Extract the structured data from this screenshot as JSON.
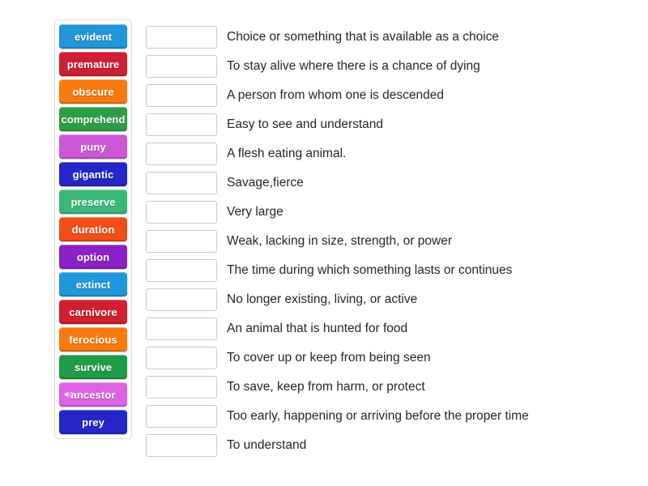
{
  "activity": {
    "type": "match-up-drag-and-drop",
    "tile_panel": {
      "tiles": [
        {
          "label": "evident",
          "color": "#2196d8",
          "has_audio": false
        },
        {
          "label": "premature",
          "color": "#cf1f35",
          "has_audio": false
        },
        {
          "label": "obscure",
          "color": "#f97b0f",
          "has_audio": false
        },
        {
          "label": "comprehend",
          "color": "#2e9e46",
          "has_audio": false
        },
        {
          "label": "puny",
          "color": "#cc58d8",
          "has_audio": false
        },
        {
          "label": "gigantic",
          "color": "#2525c8",
          "has_audio": false
        },
        {
          "label": "preserve",
          "color": "#3cb878",
          "has_audio": false
        },
        {
          "label": "duration",
          "color": "#f04e16",
          "has_audio": false
        },
        {
          "label": "option",
          "color": "#8a22c8",
          "has_audio": false
        },
        {
          "label": "extinct",
          "color": "#1f97db",
          "has_audio": false
        },
        {
          "label": "carnivore",
          "color": "#d01f30",
          "has_audio": false
        },
        {
          "label": "ferocious",
          "color": "#f97b0f",
          "has_audio": false
        },
        {
          "label": "survive",
          "color": "#219a45",
          "has_audio": false
        },
        {
          "label": "ancestor",
          "color": "#dd63e4",
          "has_audio": true,
          "audio_icon": "speaker-icon"
        },
        {
          "label": "prey",
          "color": "#2525c8",
          "has_audio": false
        }
      ]
    },
    "rows": [
      {
        "answer": "",
        "definition": "Choice or something that is available as a choice"
      },
      {
        "answer": "",
        "definition": "To stay alive where there is a chance of dying"
      },
      {
        "answer": "",
        "definition": "A person from whom one is descended"
      },
      {
        "answer": "",
        "definition": "Easy to see and understand"
      },
      {
        "answer": "",
        "definition": "A flesh eating animal."
      },
      {
        "answer": "",
        "definition": "Savage,fierce"
      },
      {
        "answer": "",
        "definition": "Very large"
      },
      {
        "answer": "",
        "definition": "Weak, lacking in size, strength, or power"
      },
      {
        "answer": "",
        "definition": "The time during which something lasts or continues"
      },
      {
        "answer": "",
        "definition": "No longer existing, living, or active"
      },
      {
        "answer": "",
        "definition": "An animal that is hunted for food"
      },
      {
        "answer": "",
        "definition": "To cover up or keep from being seen"
      },
      {
        "answer": "",
        "definition": "To save, keep from harm, or protect"
      },
      {
        "answer": "",
        "definition": "Too early, happening or arriving before the proper time"
      },
      {
        "answer": "",
        "definition": "To understand"
      }
    ]
  },
  "theme": {
    "page_background": "#ffffff",
    "panel_border": "#d9d9d9",
    "dropzone_border": "#c9c9c9",
    "text_color": "#262626"
  }
}
